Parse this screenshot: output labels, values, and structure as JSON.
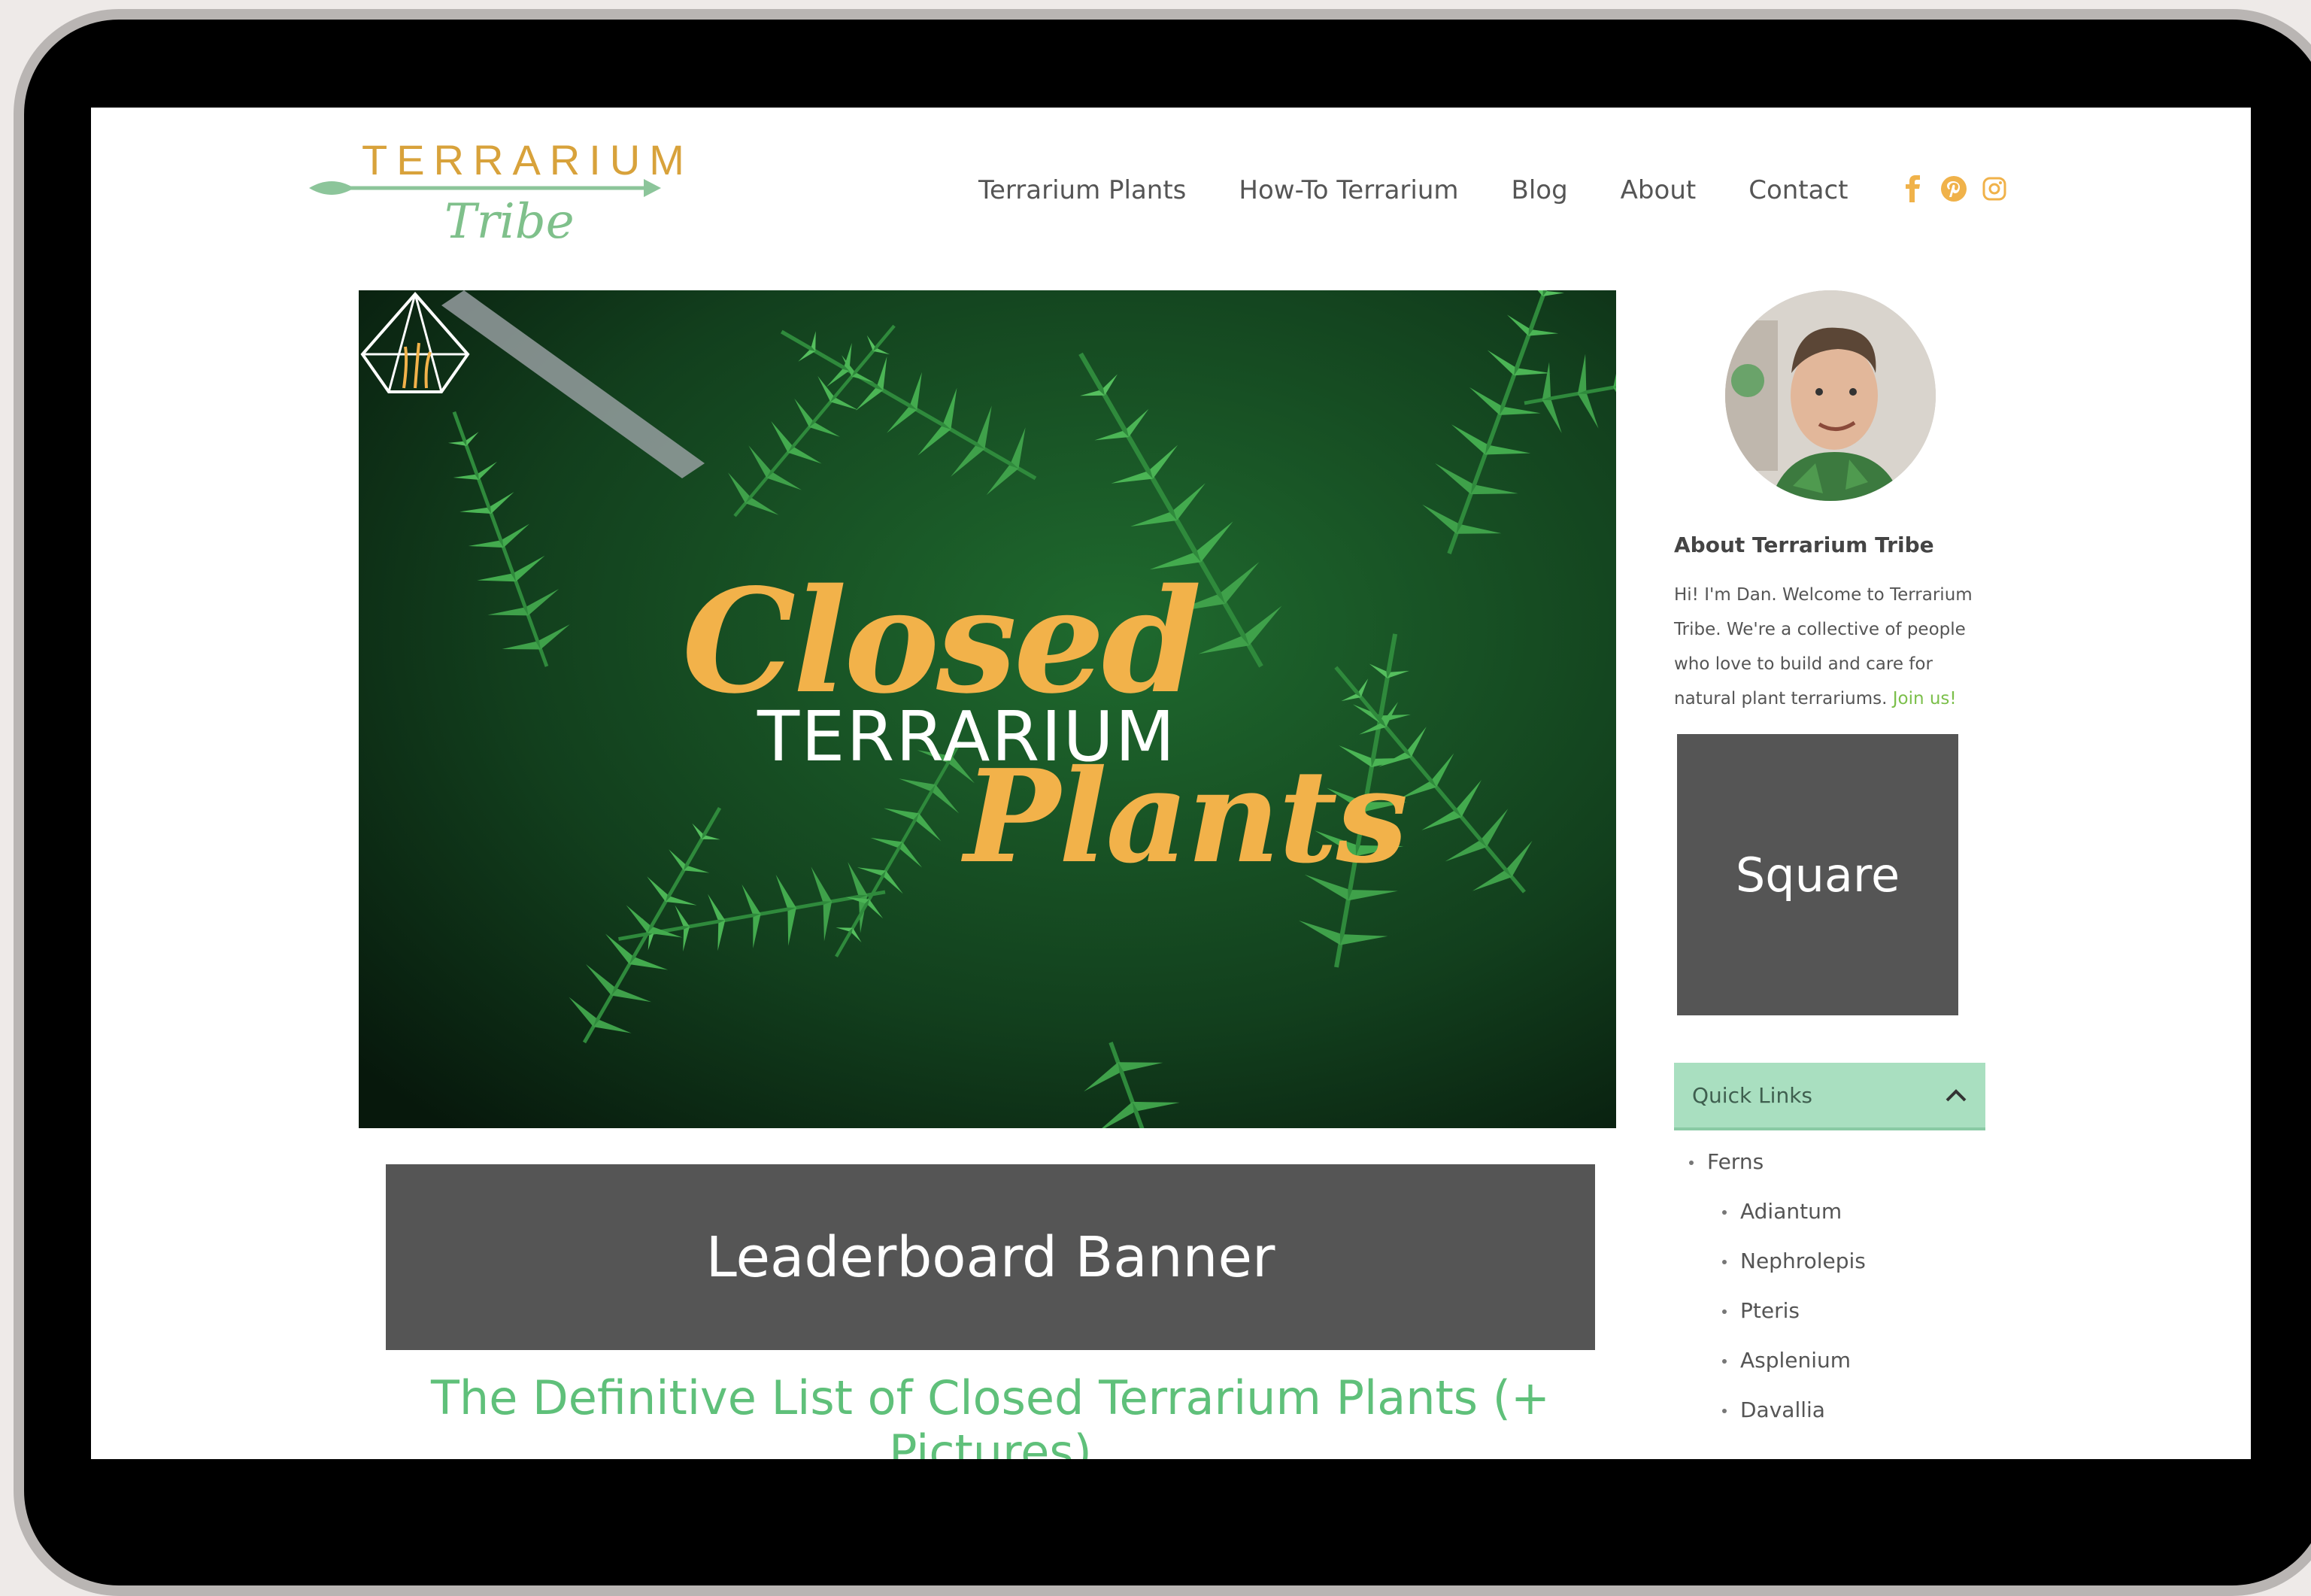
{
  "site": {
    "logo_word": "TERRARIUM",
    "logo_script": "Tribe"
  },
  "nav": {
    "items": [
      "Terrarium Plants",
      "How-To Terrarium",
      "Blog",
      "About",
      "Contact"
    ]
  },
  "social": {
    "icons": [
      "facebook-icon",
      "pinterest-icon",
      "instagram-icon"
    ],
    "color": "#f0b24a"
  },
  "hero": {
    "line1": "Closed",
    "line2": "TERRARIUM",
    "line3": "Plants"
  },
  "ads": {
    "leaderboard": "Leaderboard Banner",
    "square": "Square"
  },
  "post": {
    "title": "The Definitive List of Closed Terrarium Plants (+ Pictures)"
  },
  "sidebar": {
    "about_title": "About Terrarium Tribe",
    "about_text": "Hi! I'm Dan. Welcome to Terrarium Tribe. We're a collective of people who love to build and care for natural plant terrariums.",
    "join_link": "Join us!",
    "quick_links_label": "Quick Links",
    "quick_links": [
      {
        "label": "Ferns",
        "level": 0
      },
      {
        "label": "Adiantum",
        "level": 1
      },
      {
        "label": "Nephrolepis",
        "level": 1
      },
      {
        "label": "Pteris",
        "level": 1
      },
      {
        "label": "Asplenium",
        "level": 1
      },
      {
        "label": "Davallia",
        "level": 1
      }
    ]
  },
  "colors": {
    "accent_green": "#5fc07a",
    "quick_links_bg": "#a9dfc0",
    "ad_gray": "#555555",
    "logo_gold": "#d8a23b"
  }
}
